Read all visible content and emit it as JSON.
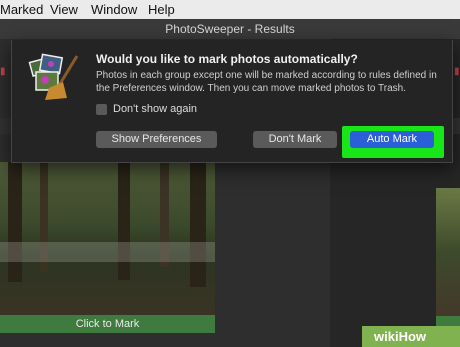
{
  "menubar": {
    "items": [
      "Marked",
      "View",
      "Window",
      "Help"
    ]
  },
  "window": {
    "title": "PhotoSweeper - Results"
  },
  "dialog": {
    "icon": "photosweeper-broom-photos-icon",
    "title": "Would you like to mark photos automatically?",
    "message": "Photos in each group except one will be marked according to rules defined in the Preferences window. Then you can move marked photos to Trash.",
    "checkbox_label": "Don't show again",
    "checkbox_checked": false,
    "buttons": {
      "show_preferences": "Show Preferences",
      "dont_mark": "Don't Mark",
      "auto_mark": "Auto Mark"
    }
  },
  "results": {
    "click_to_mark": "Click to Mark"
  },
  "watermark": {
    "text": "wikiHow"
  },
  "colors": {
    "highlight": "#19e619",
    "primary_button": "#2a5fd8",
    "mark_bar": "#3f7a3f"
  }
}
